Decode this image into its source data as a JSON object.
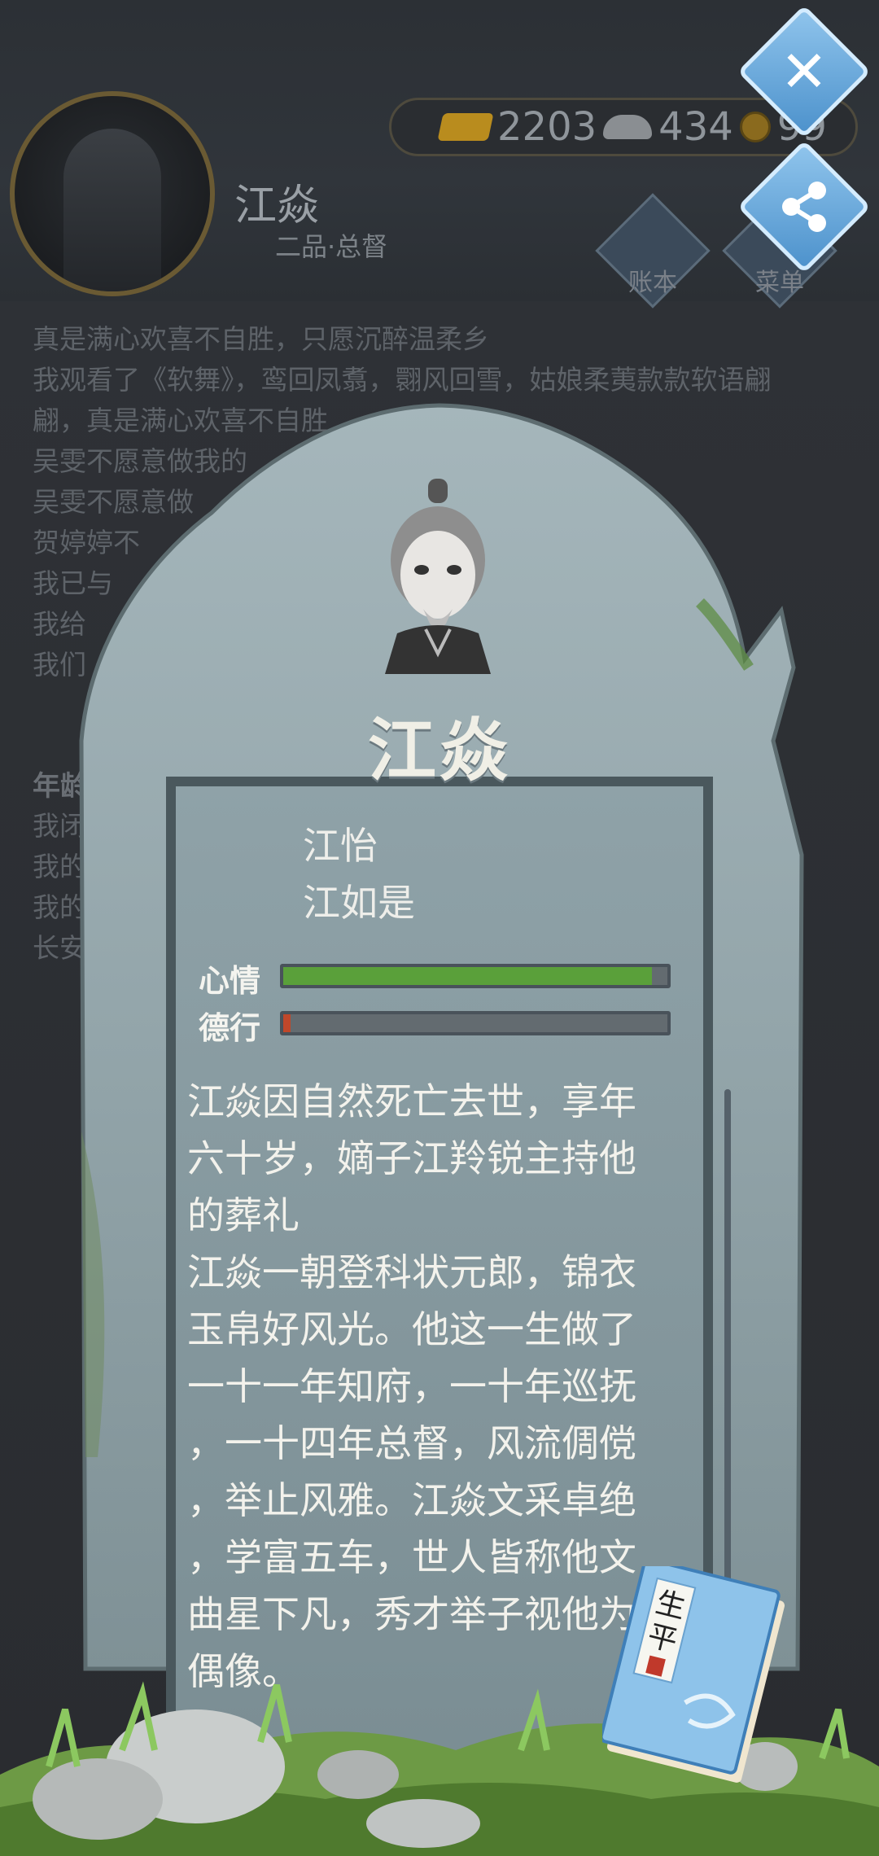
{
  "header": {
    "name": "江焱",
    "rank": "二品·总督",
    "currency": {
      "gold": "2203",
      "silver": "434",
      "coins": "99"
    },
    "ledger_label": "账本",
    "menu_label": "菜单"
  },
  "log_lines": [
    "真是满心欢喜不自胜，只愿沉醉温柔乡",
    "我观看了《软舞》，鸾回凤翥，翾风回雪，姑娘柔荑款款软语翩",
    "翩，真是满心欢喜不自胜",
    "吴雯不愿意做我的",
    "吴雯不愿意做",
    "贺婷婷不",
    "我已与",
    "我给",
    "我们"
  ],
  "log_age_head": "年龄",
  "log_lines2": [
    "我闭",
    "我的",
    "我的",
    "长安"
  ],
  "tomb": {
    "deceased_name": "江焱",
    "family": [
      "江怡",
      "江如是"
    ],
    "stats": [
      {
        "label": "心情",
        "value": 0.96,
        "color": "#5aa03a"
      },
      {
        "label": "德行",
        "value": 0.02,
        "color": "#c0472a"
      }
    ],
    "epitaph": [
      "江焱因自然死亡去世，享年",
      "六十岁，嫡子江羚锐主持他",
      "的葬礼",
      "江焱一朝登科状元郎，锦衣",
      "玉帛好风光。他这一生做了",
      "一十一年知府，一十年巡抚",
      "，一十四年总督，风流倜傥",
      "，举止风雅。江焱文采卓绝",
      "，学富五车，世人皆称他文",
      "曲星下凡，秀才举子视他为",
      "偶像。"
    ],
    "book_title": "生平"
  }
}
